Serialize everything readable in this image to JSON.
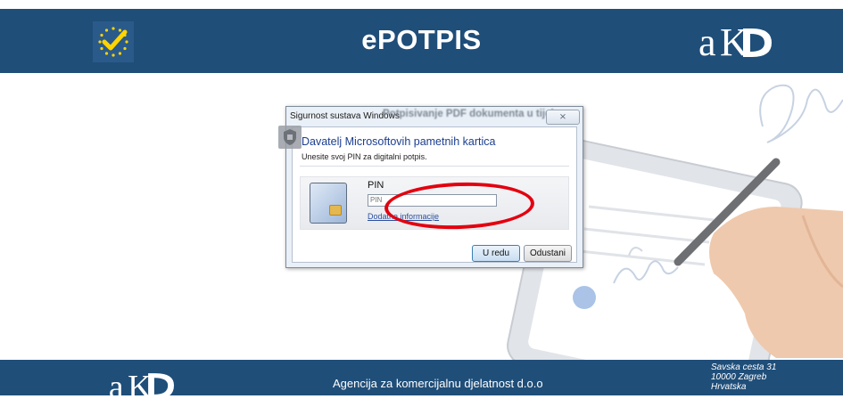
{
  "header": {
    "title": "ePOTPIS",
    "eu_logo_icon": "eu-stars-checkmark-icon",
    "brand_logo_icon": "akd-logo",
    "background_color": "#1f4e79"
  },
  "dialog": {
    "window_title": "Sigurnost sustava Windows",
    "blurred_background_text": "Potpisivanje PDF dokumenta u tijeku",
    "close_label": "⨯",
    "provider_title": "Davatelj Microsoftovih pametnih kartica",
    "provider_subtitle": "Unesite svoj PIN za digitalni potpis.",
    "pin_label": "PIN",
    "pin_placeholder": "PIN",
    "more_info_link": "Dodatne informacije",
    "ok_button": "U redu",
    "cancel_button": "Odustani",
    "card_icon": "smart-card-icon"
  },
  "annotation": {
    "color": "#e3000f",
    "shape": "ellipse-highlight-pin-field"
  },
  "footer": {
    "company_name": "Agencija za komercijalnu djelatnost d.o.o",
    "address_line1": "Savska cesta 31",
    "address_line2": "10000 Zagreb",
    "address_line3": "Hrvatska",
    "background_color": "#1f4e79"
  }
}
